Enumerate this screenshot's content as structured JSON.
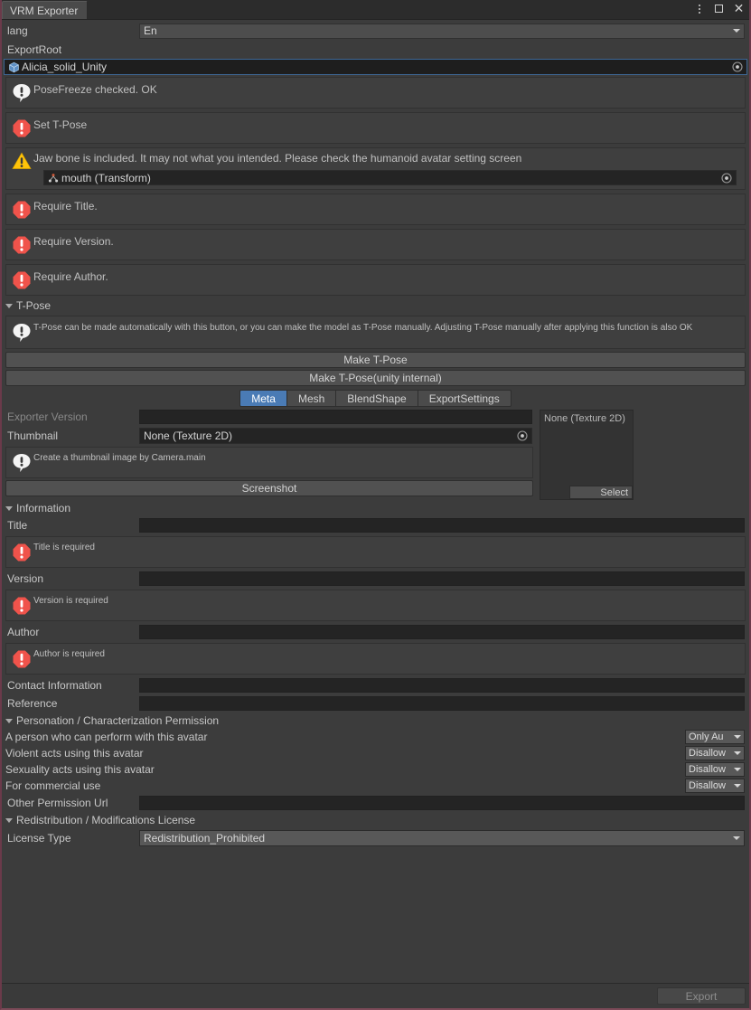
{
  "window": {
    "tab_title": "VRM Exporter",
    "controls": {
      "menu": "kebab-menu-icon",
      "maximize": "maximize-icon",
      "close": "close-icon"
    }
  },
  "top": {
    "lang_label": "lang",
    "lang_value": "En",
    "export_root_label": "ExportRoot",
    "export_root_value": "Alicia_solid_Unity"
  },
  "messages": [
    {
      "severity": "info",
      "text": "PoseFreeze checked. OK"
    },
    {
      "severity": "error",
      "text": "Set T-Pose"
    },
    {
      "severity": "warn",
      "text": "Jaw bone is included. It may not what you intended. Please check the humanoid avatar setting screen",
      "object_value": "mouth (Transform)"
    },
    {
      "severity": "error",
      "text": "Require Title."
    },
    {
      "severity": "error",
      "text": "Require Version."
    },
    {
      "severity": "error",
      "text": "Require Author."
    }
  ],
  "tpose": {
    "foldout_label": "T-Pose",
    "help_text": "T-Pose can be made automatically with this button, or you can make the model as T-Pose manually. Adjusting T-Pose manually after applying this function is also OK",
    "buttons": [
      "Make T-Pose",
      "Make T-Pose(unity internal)"
    ]
  },
  "tabs": [
    {
      "label": "Meta",
      "active": true
    },
    {
      "label": "Mesh",
      "active": false
    },
    {
      "label": "BlendShape",
      "active": false
    },
    {
      "label": "ExportSettings",
      "active": false
    }
  ],
  "meta": {
    "exporter_version_label": "Exporter Version",
    "exporter_version_value": "",
    "thumbnail_label": "Thumbnail",
    "thumbnail_value": "None (Texture 2D)",
    "thumbnail_help": "Create a thumbnail image by Camera.main",
    "screenshot_button": "Screenshot",
    "preview": {
      "caption": "None (Texture 2D)",
      "select_label": "Select"
    }
  },
  "information": {
    "foldout_label": "Information",
    "fields": [
      {
        "label": "Title",
        "value": "",
        "error": "Title is required"
      },
      {
        "label": "Version",
        "value": "",
        "error": "Version is required"
      },
      {
        "label": "Author",
        "value": "",
        "error": "Author is required"
      }
    ],
    "contact_label": "Contact Information",
    "contact_value": "",
    "reference_label": "Reference",
    "reference_value": ""
  },
  "permission": {
    "foldout_label": "Personation / Characterization Permission",
    "rows": [
      {
        "label": "A person who can perform with this avatar",
        "value": "Only Au"
      },
      {
        "label": "Violent acts using this avatar",
        "value": "Disallow"
      },
      {
        "label": "Sexuality acts using this avatar",
        "value": "Disallow"
      },
      {
        "label": "For commercial use",
        "value": "Disallow"
      }
    ],
    "other_url_label": "Other Permission Url",
    "other_url_value": ""
  },
  "license": {
    "foldout_label": "Redistribution / Modifications License",
    "type_label": "License Type",
    "type_value": "Redistribution_Prohibited"
  },
  "footer": {
    "export_label": "Export"
  },
  "colors": {
    "background": "#3c3c3c",
    "accent": "#4a7bb5",
    "error": "#f0534b",
    "warn": "#ffc40a",
    "field": "#242424",
    "window_border": "#6b3a4a"
  }
}
